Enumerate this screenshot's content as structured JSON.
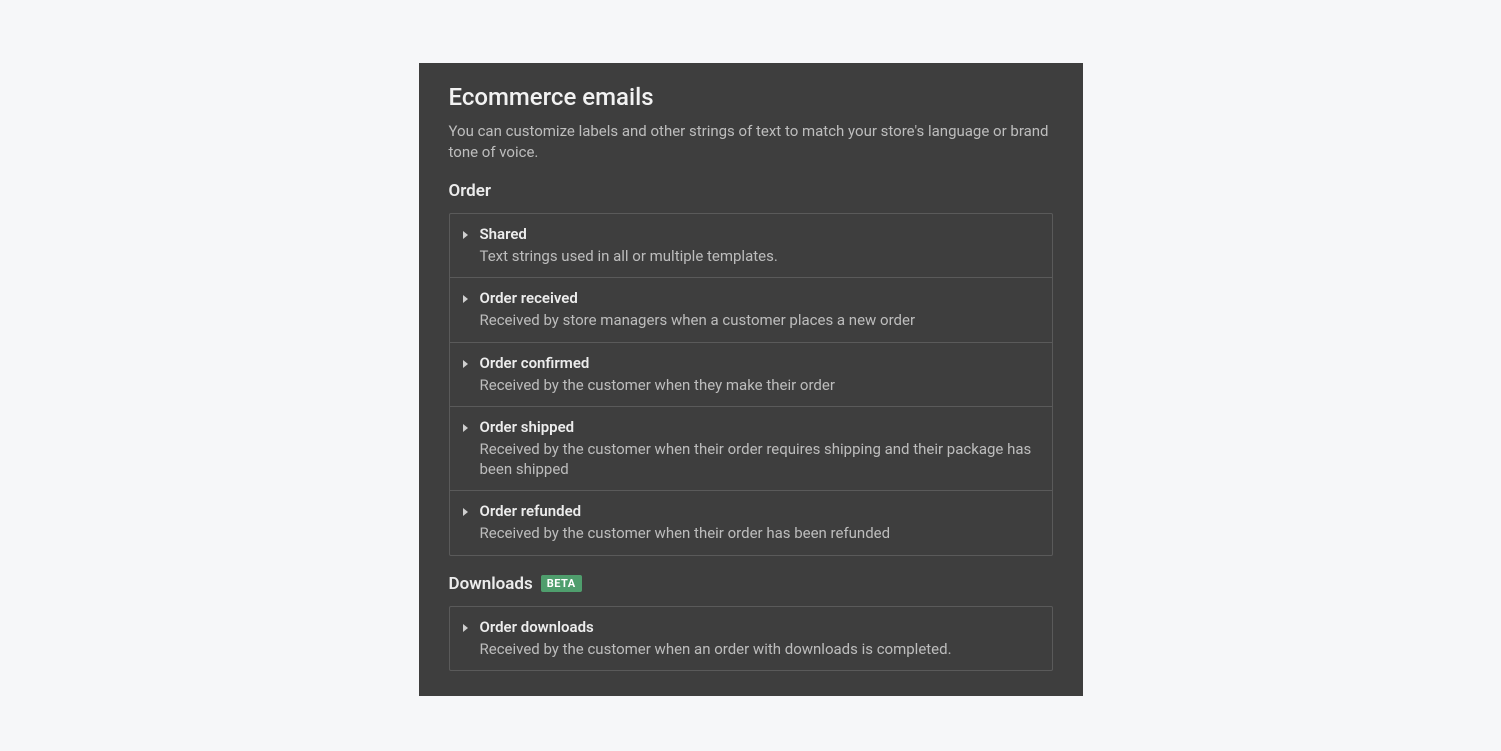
{
  "title": "Ecommerce emails",
  "description": "You can customize labels and other strings of text to match your store's language or brand tone of voice.",
  "sections": [
    {
      "title": "Order",
      "badge": null,
      "items": [
        {
          "title": "Shared",
          "desc": "Text strings used in all or multiple templates."
        },
        {
          "title": "Order received",
          "desc": "Received by store managers when a customer places a new order"
        },
        {
          "title": "Order confirmed",
          "desc": "Received by the customer when they make their order"
        },
        {
          "title": "Order shipped",
          "desc": "Received by the customer when their order requires shipping and their package has been shipped"
        },
        {
          "title": "Order refunded",
          "desc": "Received by the customer when their order has been refunded"
        }
      ]
    },
    {
      "title": "Downloads",
      "badge": "BETA",
      "items": [
        {
          "title": "Order downloads",
          "desc": "Received by the customer when an order with downloads is completed."
        }
      ]
    }
  ]
}
